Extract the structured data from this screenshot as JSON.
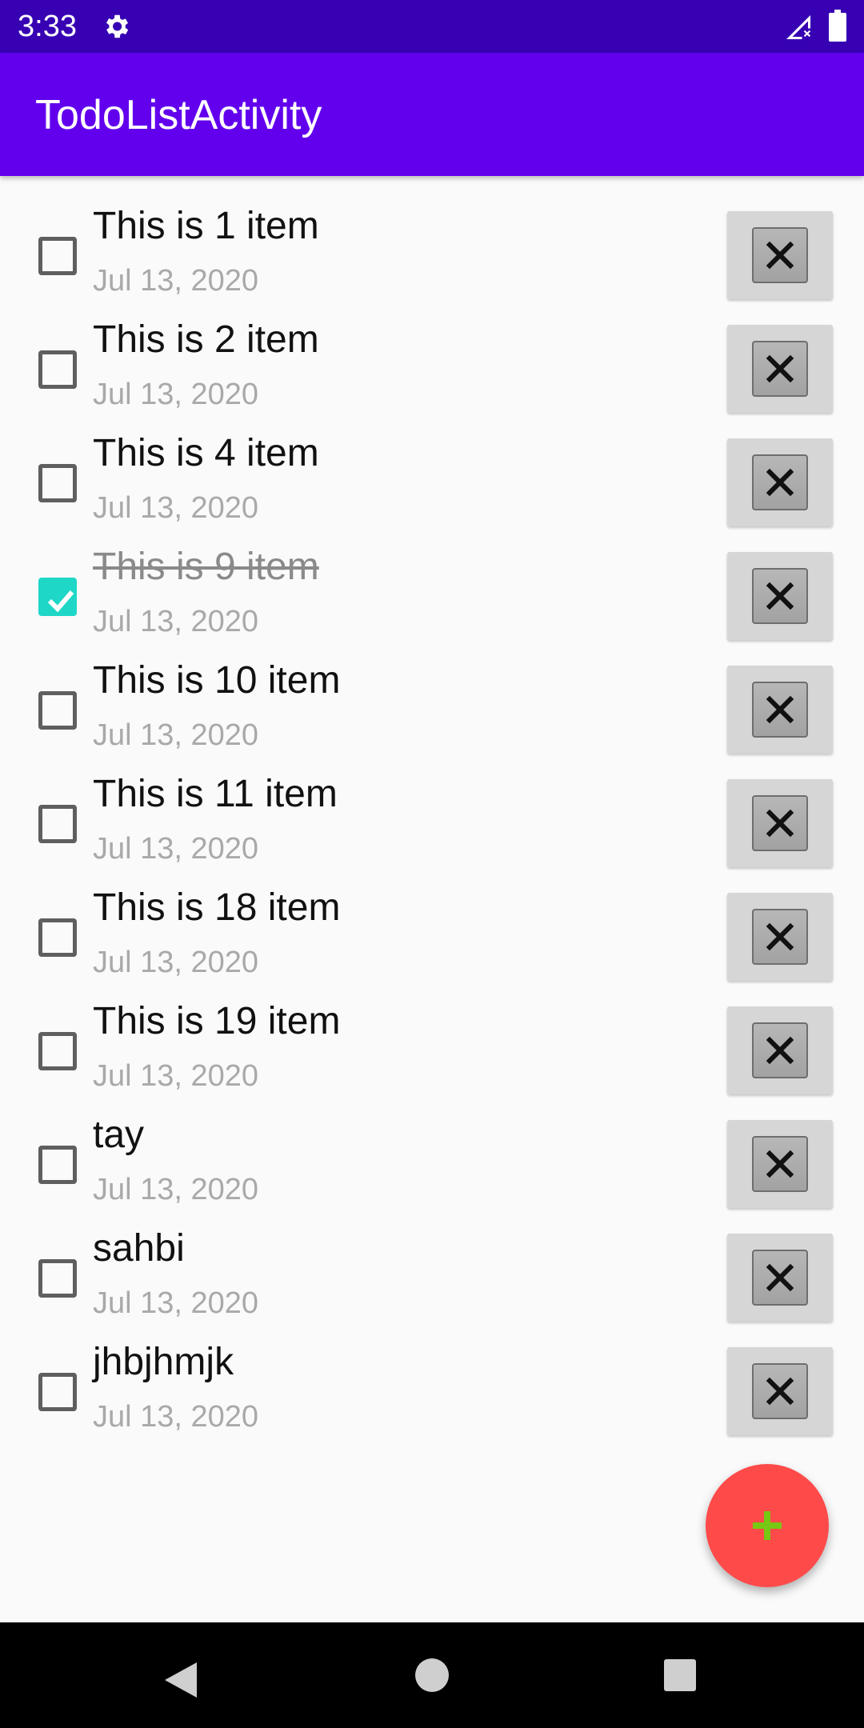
{
  "status_bar": {
    "time": "3:33",
    "icons": [
      "gear-icon",
      "signal-icon",
      "battery-icon"
    ]
  },
  "app_bar": {
    "title": "TodoListActivity",
    "color": "#6200ee"
  },
  "todo_items": [
    {
      "title": "This is 1 item",
      "date": "Jul 13, 2020",
      "done": false
    },
    {
      "title": "This is 2 item",
      "date": "Jul 13, 2020",
      "done": false
    },
    {
      "title": "This is 4 item",
      "date": "Jul 13, 2020",
      "done": false
    },
    {
      "title": "This is 9 item",
      "date": "Jul 13, 2020",
      "done": true
    },
    {
      "title": "This is 10 item",
      "date": "Jul 13, 2020",
      "done": false
    },
    {
      "title": "This is 11 item",
      "date": "Jul 13, 2020",
      "done": false
    },
    {
      "title": "This is 18 item",
      "date": "Jul 13, 2020",
      "done": false
    },
    {
      "title": "This is 19 item",
      "date": "Jul 13, 2020",
      "done": false
    },
    {
      "title": "tay",
      "date": "Jul 13, 2020",
      "done": false
    },
    {
      "title": "sahbi",
      "date": "Jul 13, 2020",
      "done": false
    },
    {
      "title": "jhbjhmjk",
      "date": "Jul 13, 2020",
      "done": false
    }
  ],
  "delete_icon": "close-icon",
  "fab": {
    "icon": "plus-icon",
    "color": "#fe4a49",
    "icon_color": "#76c814"
  },
  "checkbox_checked_color": "#1fd7c7",
  "nav_bar": {
    "icons": [
      "back-icon",
      "home-icon",
      "recent-apps-icon"
    ]
  }
}
